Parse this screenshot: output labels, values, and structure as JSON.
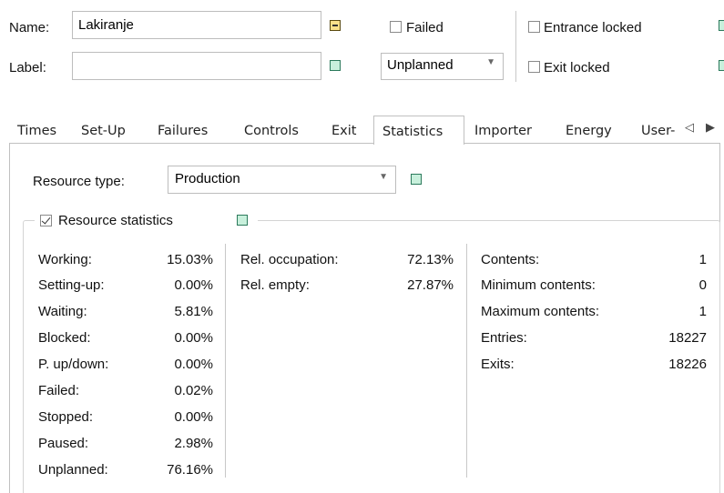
{
  "header": {
    "name_label": "Name:",
    "name_value": "Lakiranje",
    "label_label": "Label:",
    "label_value": "",
    "failed_label": "Failed",
    "failed_checked": false,
    "unplanned_value": "Unplanned",
    "entrance_locked_label": "Entrance locked",
    "entrance_locked_checked": false,
    "exit_locked_label": "Exit locked",
    "exit_locked_checked": false
  },
  "tabs": [
    {
      "label": "Times",
      "color": "#22cc22"
    },
    {
      "label": "Set-Up",
      "color": "#b08840"
    },
    {
      "label": "Failures",
      "color": "#e01010"
    },
    {
      "label": "Controls",
      "color": "#5ec8ee"
    },
    {
      "label": "Exit",
      "color": "#3a88e0"
    },
    {
      "label": "Statistics",
      "color": "#ffffff",
      "active": true
    },
    {
      "label": "Importer",
      "color": "#f08a1a"
    },
    {
      "label": "Energy",
      "color": "#e8e020"
    },
    {
      "label": "User-",
      "color": "#808080"
    }
  ],
  "statistics": {
    "resource_type_label": "Resource type:",
    "resource_type_value": "Production",
    "resource_statistics_label": "Resource statistics",
    "resource_statistics_checked": true,
    "col1": [
      {
        "label": "Working:",
        "value": "15.03%"
      },
      {
        "label": "Setting-up:",
        "value": "0.00%"
      },
      {
        "label": "Waiting:",
        "value": "5.81%"
      },
      {
        "label": "Blocked:",
        "value": "0.00%"
      },
      {
        "label": "P. up/down:",
        "value": "0.00%"
      },
      {
        "label": "Failed:",
        "value": "0.02%"
      },
      {
        "label": "Stopped:",
        "value": "0.00%"
      },
      {
        "label": "Paused:",
        "value": "2.98%"
      },
      {
        "label": "Unplanned:",
        "value": "76.16%"
      }
    ],
    "col2": [
      {
        "label": "Rel. occupation:",
        "value": "72.13%"
      },
      {
        "label": "Rel. empty:",
        "value": "27.87%"
      }
    ],
    "col3": [
      {
        "label": "Contents:",
        "value": "1"
      },
      {
        "label": "Minimum contents:",
        "value": "0"
      },
      {
        "label": "Maximum contents:",
        "value": "1"
      },
      {
        "label": "Entries:",
        "value": "18227"
      },
      {
        "label": "Exits:",
        "value": "18226"
      }
    ]
  }
}
